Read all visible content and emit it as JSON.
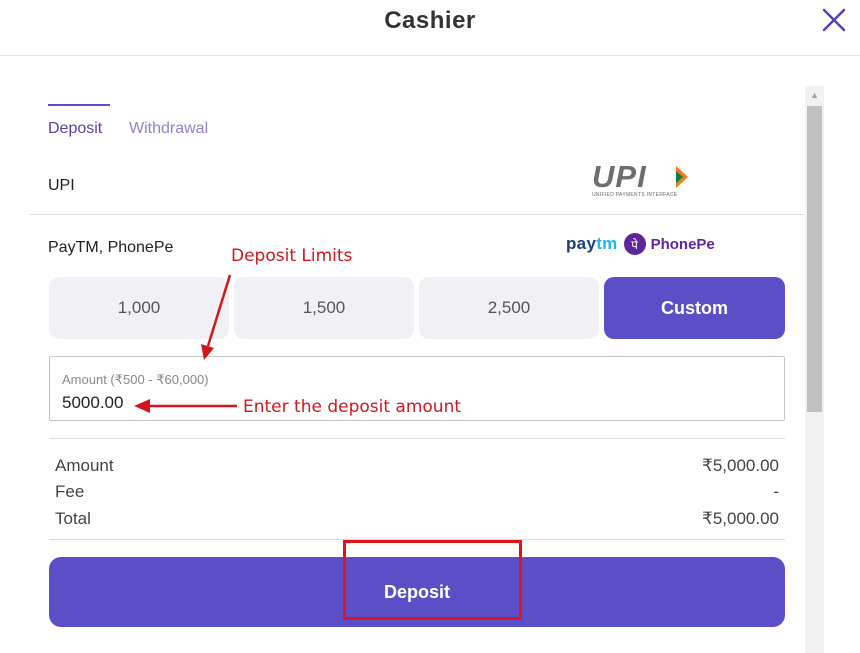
{
  "header": {
    "title": "Cashier",
    "close_icon": "close-icon"
  },
  "tabs": [
    {
      "label": "Deposit",
      "active": true
    },
    {
      "label": "Withdrawal",
      "active": false
    }
  ],
  "methods": {
    "upi": {
      "label": "UPI",
      "logo_text": "UPI",
      "logo_subtitle": "UNIFIED PAYMENTS INTERFACE"
    },
    "wallets": {
      "label": "PayTM, PhonePe",
      "logo_paytm_a": "pay",
      "logo_paytm_b": "tm",
      "logo_phonepe_glyph": "पे",
      "logo_phonepe": "PhonePe"
    }
  },
  "amount_options": [
    {
      "label": "1,000"
    },
    {
      "label": "1,500"
    },
    {
      "label": "2,500"
    },
    {
      "label": "Custom",
      "selected": true
    }
  ],
  "amount_field": {
    "label": "Amount (₹500 - ₹60,000)",
    "value": "5000.00"
  },
  "summary": {
    "amount_label": "Amount",
    "amount_value": "₹5,000.00",
    "fee_label": "Fee",
    "fee_value": "-",
    "total_label": "Total",
    "total_value": "₹5,000.00"
  },
  "deposit_button": {
    "label": "Deposit"
  },
  "annotations": {
    "deposit_limits": "Deposit Limits",
    "enter_amount": "Enter the deposit amount"
  },
  "colors": {
    "accent": "#5b4fc7",
    "inactive_tab": "#8a86cf",
    "option_bg": "#f1f1f5",
    "annotation": "#d4161f"
  }
}
